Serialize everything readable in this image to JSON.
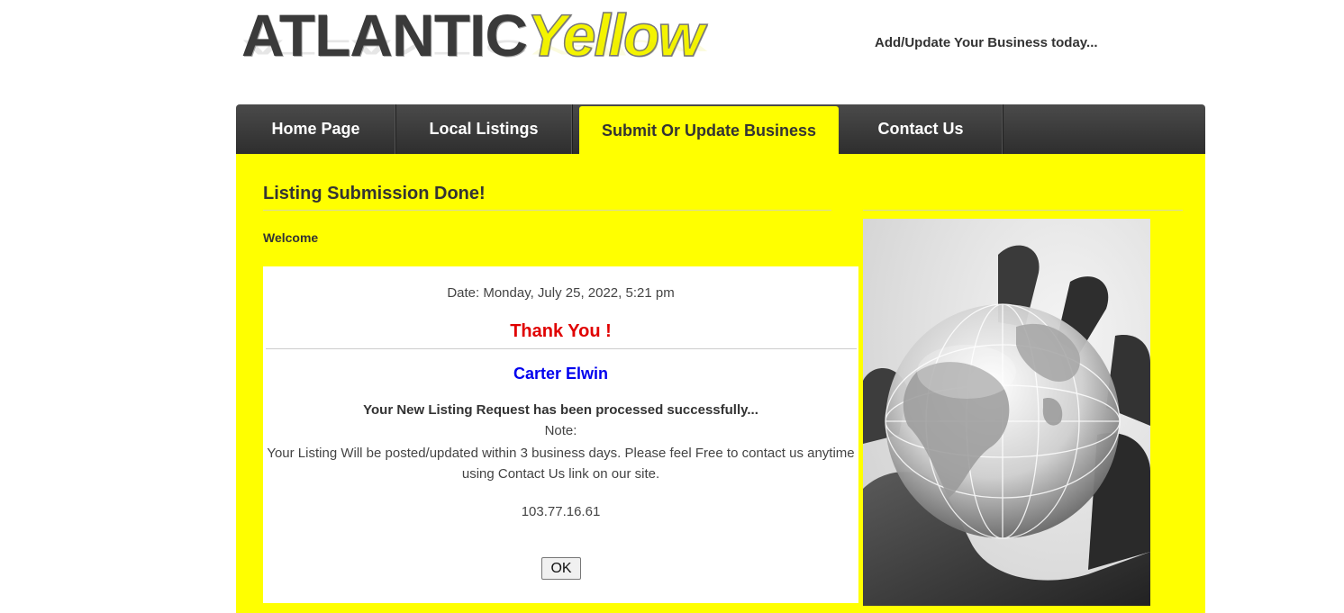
{
  "header": {
    "logo_dark": "ATLANTIC",
    "logo_light": "Yellow",
    "tagline": "Add/Update Your Business today..."
  },
  "nav": {
    "items": [
      {
        "label": "Home Page"
      },
      {
        "label": "Local Listings"
      },
      {
        "label": "Submit Or Update Business"
      },
      {
        "label": "Contact Us"
      }
    ]
  },
  "main": {
    "title": "Listing Submission Done!",
    "welcome": "Welcome",
    "date": "Date: Monday, July 25, 2022, 5:21 pm",
    "thanks": "Thank You !",
    "name": "Carter Elwin",
    "processed": "Your New Listing Request has been processed successfully...",
    "note": "Note:",
    "message_line1": "Your Listing Will be posted/updated within 3 business days. Please feel Free to contact us anytime",
    "message_line2": "using Contact Us link on our site.",
    "ip": "103.77.16.61",
    "ok_label": "OK"
  },
  "colors": {
    "accent": "#ffff00",
    "nav_bg": "#3a3a3a",
    "thanks": "#e00000",
    "name": "#0000ee"
  },
  "icons": [
    "globe-in-hand-image"
  ]
}
